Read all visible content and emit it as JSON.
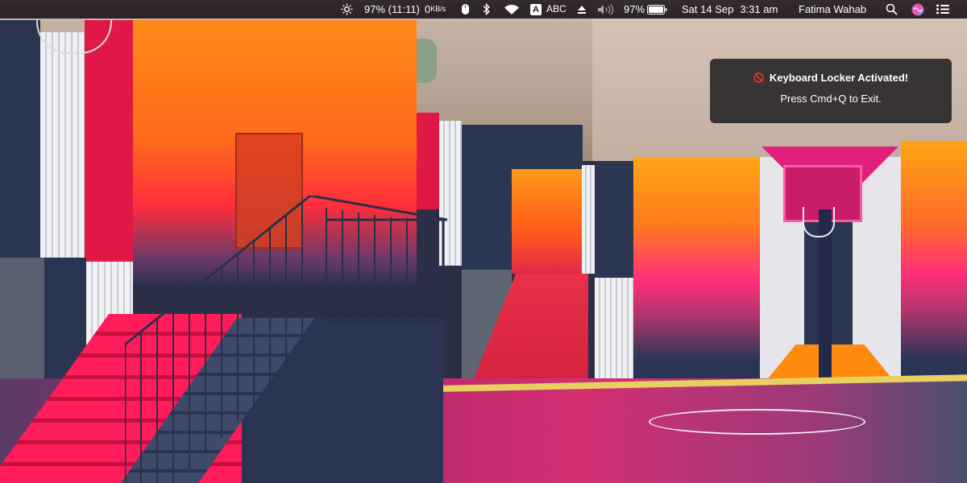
{
  "menubar": {
    "battery_text": "97% (11:11)",
    "network_speed": "0",
    "network_unit": "KB/s",
    "input_source": "ABC",
    "input_source_badge": "A",
    "battery_percent": "97%",
    "date": "Sat 14 Sep",
    "time": "3:31 am",
    "user_name": "Fatima Wahab",
    "icons": [
      "brightness-icon",
      "mouse-icon",
      "bluetooth-icon",
      "wifi-icon",
      "input-source-icon",
      "eject-icon",
      "volume-icon",
      "battery-icon",
      "spotlight-search-icon",
      "siri-icon",
      "notification-center-icon"
    ]
  },
  "notification": {
    "title": "Keyboard Locker Activated!",
    "body": "Press Cmd+Q to Exit.",
    "icon": "prohibited-icon",
    "accent_color": "#e0332c"
  }
}
